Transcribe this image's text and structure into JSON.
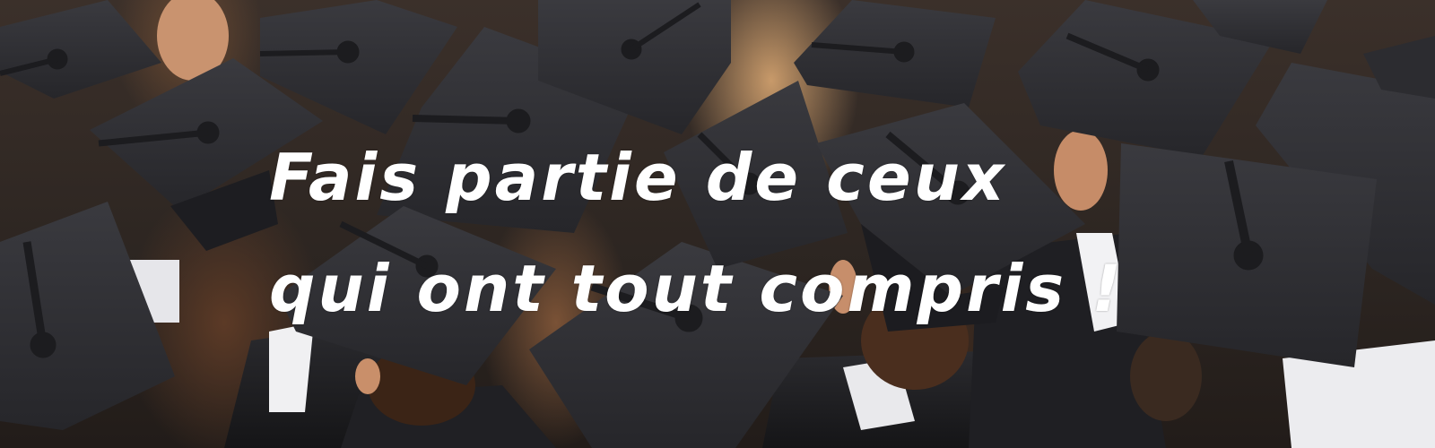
{
  "banner": {
    "headline_line1": "Fais partie de ceux",
    "headline_line2": "qui ont tout compris !",
    "text_color": "#ffffff",
    "cap_color": "#2f2f33",
    "tassel_color": "#1c1c1f"
  }
}
